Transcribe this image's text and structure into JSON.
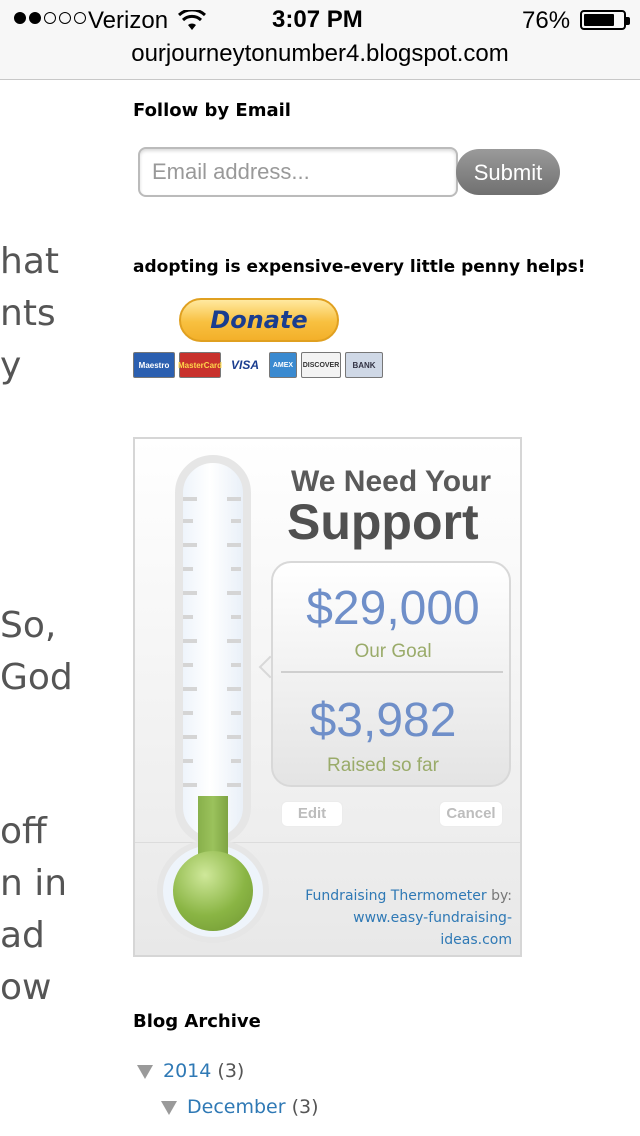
{
  "status_bar": {
    "carrier": "Verizon",
    "time": "3:07 PM",
    "battery_percent": "76%",
    "battery_level": 0.76,
    "signal_bars_filled": 2,
    "signal_bars_total": 5
  },
  "browser": {
    "url": "ourjourneytonumber4.blogspot.com"
  },
  "post_fragments": [
    "hat",
    "nts",
    "y",
    "",
    "",
    "",
    "So,",
    "God",
    "",
    "",
    "off",
    "n in",
    "ad",
    "ow"
  ],
  "follow_by_email": {
    "title": "Follow by Email",
    "placeholder": "Email address...",
    "submit_label": "Submit"
  },
  "donate": {
    "title": "adopting is expensive-every little penny helps!",
    "button_label": "Donate",
    "cards": [
      "Maestro",
      "MasterCard",
      "VISA",
      "AMEX",
      "DISCOVER",
      "BANK"
    ]
  },
  "thermometer": {
    "headline_small": "We Need Your",
    "headline_big": "Support",
    "goal_amount": "$29,000",
    "goal_label": "Our Goal",
    "raised_amount": "$3,982",
    "raised_label": "Raised so far",
    "raised_fraction": 0.137,
    "edit_label": "Edit",
    "cancel_label": "Cancel",
    "credit_link": "Fundraising Thermometer",
    "credit_by": " by:",
    "credit_site": "www.easy-fundraising-ideas.com"
  },
  "blog_archive": {
    "title": "Blog Archive",
    "year": "2014",
    "year_count": "(3)",
    "month": "December",
    "month_count": "(3)"
  },
  "colors": {
    "link": "#2f79b5",
    "amount": "#6f8fc9",
    "progress": "#8ab544"
  }
}
